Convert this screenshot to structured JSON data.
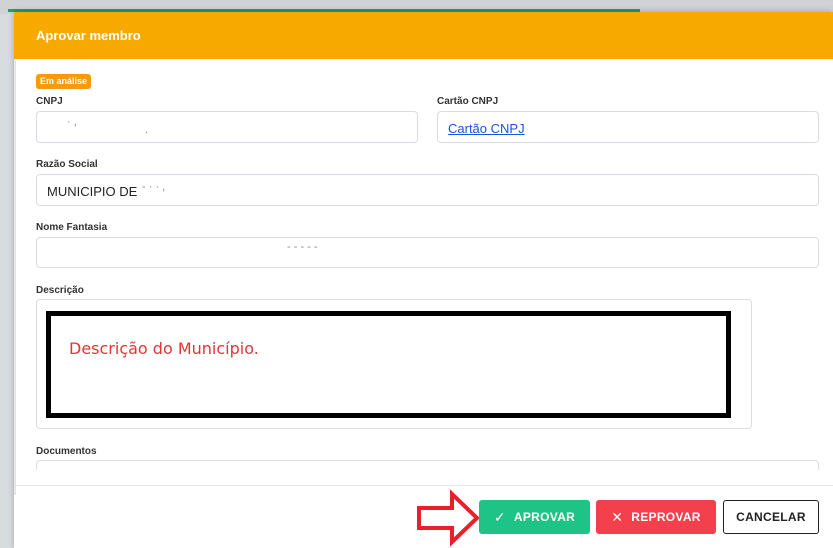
{
  "modal": {
    "title": "Aprovar membro",
    "status_badge": "Em análise"
  },
  "fields": {
    "cnpj": {
      "label": "CNPJ",
      "value": ""
    },
    "cartao_cnpj": {
      "label": "Cartão CNPJ",
      "value": "Cartão CNPJ"
    },
    "razao_social": {
      "label": "Razão Social",
      "value": "MUNICIPIO DE"
    },
    "nome_fantasia": {
      "label": "Nome Fantasia",
      "value": ""
    },
    "descricao": {
      "label": "Descrição",
      "value": "Descrição do Município."
    },
    "documentos": {
      "label": "Documentos"
    }
  },
  "actions": {
    "approve_label": "APROVAR",
    "reject_label": "REPROVAR",
    "cancel_label": "CANCELAR"
  },
  "colors": {
    "header": "#f8a900",
    "badge": "#f59b0c",
    "approve": "#1ec386",
    "reject": "#f4404c",
    "annotation_arrow": "#e8202a",
    "description_text": "#e03535"
  },
  "icons": {
    "approve": "check-icon",
    "reject": "x-icon",
    "annotation": "right-arrow-outline-icon"
  }
}
